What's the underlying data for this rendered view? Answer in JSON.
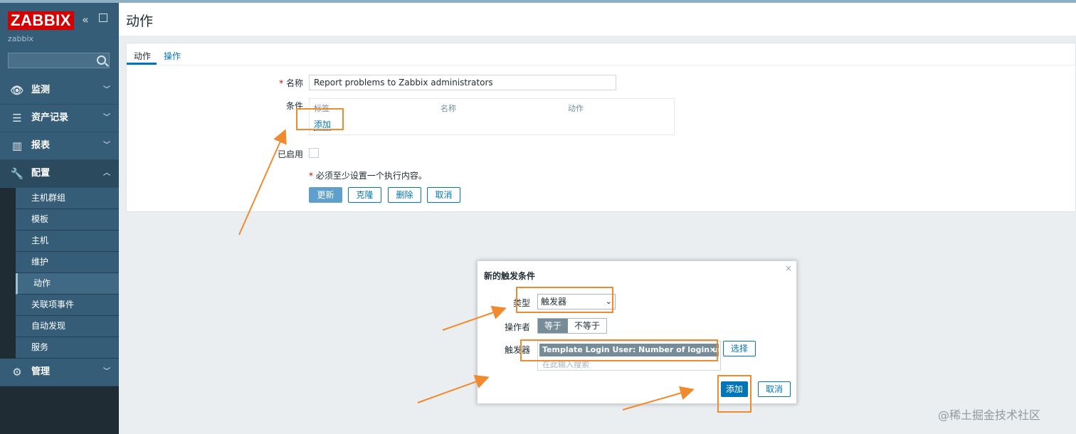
{
  "app": {
    "logo": "ZABBIX",
    "server": "zabbix",
    "search_placeholder": ""
  },
  "icons": {
    "collapse": "double-chevron-left-icon",
    "kiosk": "expand-icon",
    "search": "search-icon"
  },
  "nav": [
    {
      "label": "监测",
      "icon": "eye-icon",
      "glyph": "👁"
    },
    {
      "label": "资产记录",
      "icon": "list-icon",
      "glyph": "☰"
    },
    {
      "label": "报表",
      "icon": "bar-chart-icon",
      "glyph": "▥"
    },
    {
      "label": "配置",
      "icon": "wrench-icon",
      "glyph": "🔧"
    },
    {
      "label": "管理",
      "icon": "gear-icon",
      "glyph": "⚙"
    }
  ],
  "config_sub": [
    "主机群组",
    "模板",
    "主机",
    "维护",
    "动作",
    "关联项事件",
    "自动发现",
    "服务"
  ],
  "page": {
    "title": "动作",
    "tabs": [
      "动作",
      "操作"
    ]
  },
  "form": {
    "name_label": "名称",
    "name_value": "Report problems to Zabbix administrators",
    "conditions_label": "条件",
    "cond_headers": [
      "标签",
      "名称",
      "动作"
    ],
    "cond_add": "添加",
    "enabled_label": "已启用",
    "note": "必须至少设置一个执行内容。",
    "buttons": {
      "update": "更新",
      "clone": "克隆",
      "delete": "删除",
      "cancel": "取消"
    }
  },
  "dialog": {
    "title": "新的触发条件",
    "close": "×",
    "type_label": "类型",
    "type_value": "触发器",
    "operator_label": "操作者",
    "operator_options": [
      "等于",
      "不等于"
    ],
    "trigger_label": "触发器",
    "trigger_chip": "Template Login User: Number of login use…",
    "trigger_placeholder": "在此输入搜索",
    "select_btn": "选择",
    "add_btn": "添加",
    "cancel_btn": "取消"
  },
  "watermark": "@稀土掘金技术社区",
  "colors": {
    "accent": "#0275b8",
    "sidebar": "#355d78",
    "annotation": "#f08a2e",
    "logo": "#d40000"
  }
}
